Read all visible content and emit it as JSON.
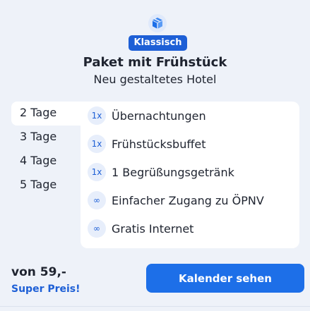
{
  "package": {
    "icon": "package-cube-icon",
    "badge": "Klassisch",
    "title": "Paket mit Frühstück",
    "subtitle": "Neu gestaltetes Hotel"
  },
  "durations": [
    {
      "label": "2 Tage",
      "selected": true
    },
    {
      "label": "3 Tage",
      "selected": false
    },
    {
      "label": "4 Tage",
      "selected": false
    },
    {
      "label": "5 Tage",
      "selected": false
    }
  ],
  "features": [
    {
      "qty": "1x",
      "label": "Übernachtungen"
    },
    {
      "qty": "1x",
      "label": "Frühstücksbuffet"
    },
    {
      "qty": "1x",
      "label": "1 Begrüßungsgetränk"
    },
    {
      "qty": "∞",
      "label": "Einfacher Zugang zu ÖPNV"
    },
    {
      "qty": "∞",
      "label": "Gratis Internet"
    }
  ],
  "price": {
    "label": "von 59,-",
    "note": "Super Preis!"
  },
  "cta_label": "Kalender sehen",
  "colors": {
    "accent": "#1d5fd6",
    "button": "#1d6fe8",
    "background": "#eef2f9"
  }
}
